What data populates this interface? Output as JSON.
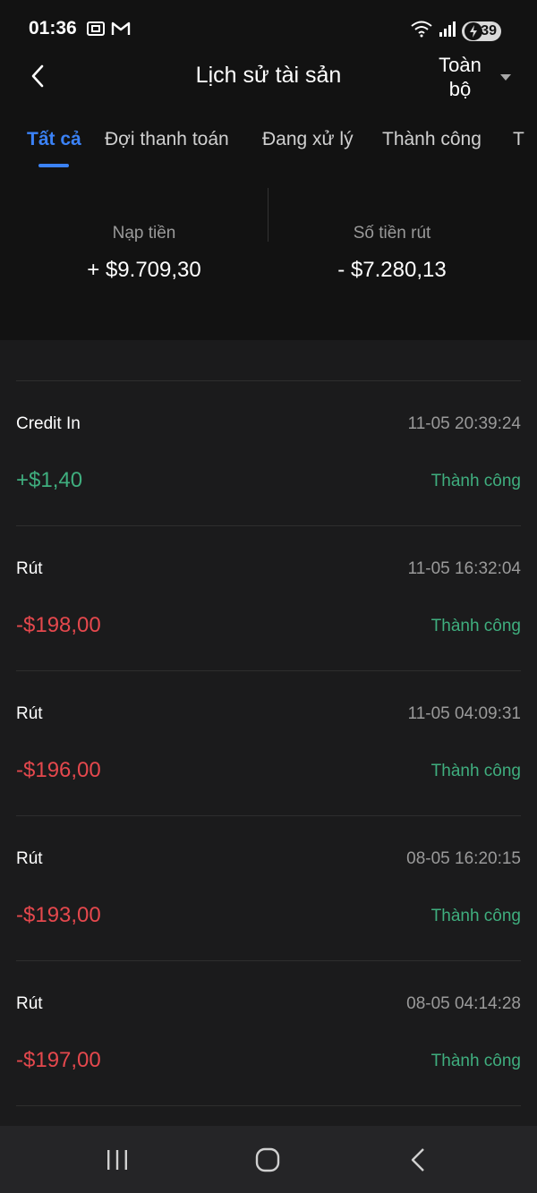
{
  "status_bar": {
    "time": "01:36",
    "battery_level": "39",
    "icons": [
      "screenshot-icon",
      "gmail-icon",
      "wifi-icon",
      "signal-icon",
      "battery-icon"
    ]
  },
  "header": {
    "title": "Lịch sử tài sản",
    "filter_label": "Toàn bộ"
  },
  "tabs": [
    {
      "label": "Tất cả",
      "active": true
    },
    {
      "label": "Đợi thanh toán",
      "active": false
    },
    {
      "label": "Đang xử lý",
      "active": false
    },
    {
      "label": "Thành công",
      "active": false
    },
    {
      "label": "T",
      "active": false
    }
  ],
  "summary": {
    "deposit_label": "Nạp tiền",
    "deposit_value": "+ $9.709,30",
    "withdraw_label": "Số tiền rút",
    "withdraw_value": "- $7.280,13"
  },
  "transactions": [
    {
      "type": "Credit In",
      "time": "11-05 20:39:24",
      "amount": "+$1,40",
      "status": "Thành công",
      "amount_color": "#3fae7e"
    },
    {
      "type": "Rút",
      "time": "11-05 16:32:04",
      "amount": "-$198,00",
      "status": "Thành công",
      "amount_color": "#e5484d"
    },
    {
      "type": "Rút",
      "time": "11-05 04:09:31",
      "amount": "-$196,00",
      "status": "Thành công",
      "amount_color": "#e5484d"
    },
    {
      "type": "Rút",
      "time": "08-05 16:20:15",
      "amount": "-$193,00",
      "status": "Thành công",
      "amount_color": "#e5484d"
    },
    {
      "type": "Rút",
      "time": "08-05 04:14:28",
      "amount": "-$197,00",
      "status": "Thành công",
      "amount_color": "#e5484d"
    }
  ],
  "colors": {
    "accent": "#3b82f6",
    "success": "#3fae7e",
    "negative": "#e5484d"
  }
}
